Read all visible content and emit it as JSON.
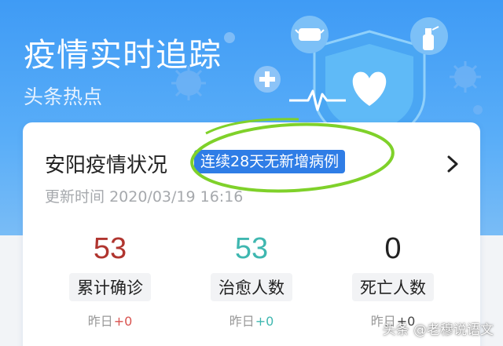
{
  "banner": {
    "title": "疫情实时追踪",
    "subtitle": "头条热点"
  },
  "card": {
    "region_title": "安阳疫情状况",
    "badge": "连续28天无新增病例",
    "update_label": "更新时间",
    "update_time": "2020/03/19 16:16",
    "stats": [
      {
        "value": "53",
        "label": "累计确诊",
        "yesterday_label": "昨日",
        "yesterday_delta": "+0",
        "value_color": "#b0352f",
        "delta_color": "#d9534f"
      },
      {
        "value": "53",
        "label": "治愈人数",
        "yesterday_label": "昨日",
        "yesterday_delta": "+0",
        "value_color": "#3fb7b0",
        "delta_color": "#3fb7b0"
      },
      {
        "value": "0",
        "label": "死亡人数",
        "yesterday_label": "昨日",
        "yesterday_delta": "+0",
        "value_color": "#222222",
        "delta_color": "#444444"
      }
    ]
  },
  "watermark": "头条 @老穆说语文",
  "colors": {
    "banner_top": "#3f9bf5",
    "badge_bg": "#2f7de6",
    "annotation_ring": "#7fd12a"
  },
  "icons": [
    "mask-icon",
    "spray-bottle-icon",
    "heart-shield-icon",
    "virus-icon",
    "plus-icon",
    "heartbeat-line-icon",
    "chevron-right-icon"
  ]
}
